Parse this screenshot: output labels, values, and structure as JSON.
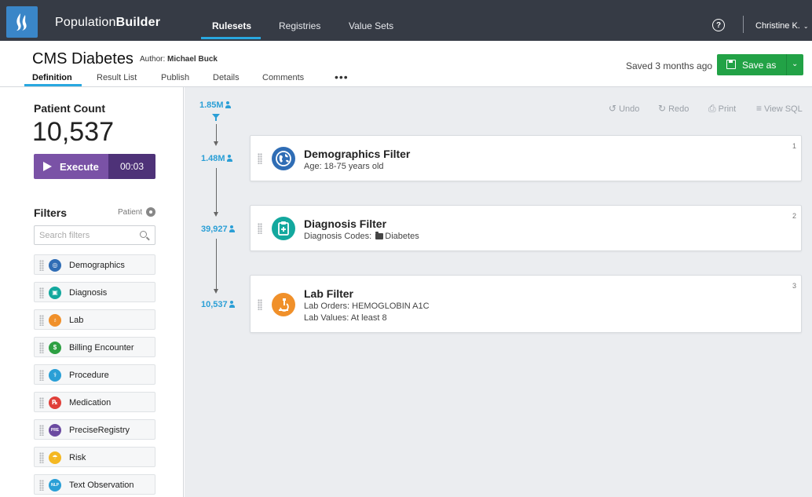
{
  "app": {
    "brand_light": "Population",
    "brand_bold": "Builder",
    "nav": [
      {
        "label": "Rulesets"
      },
      {
        "label": "Registries"
      },
      {
        "label": "Value Sets"
      }
    ],
    "help_glyph": "?",
    "user": "Christine K.",
    "user_chevron": "⌄"
  },
  "document": {
    "title": "CMS Diabetes",
    "author_label": "Author:",
    "author_name": "Michael Buck",
    "tabs": [
      {
        "label": "Definition"
      },
      {
        "label": "Result List"
      },
      {
        "label": "Publish"
      },
      {
        "label": "Details"
      },
      {
        "label": "Comments"
      }
    ],
    "more": "•••",
    "saved_status": "Saved 3 months ago",
    "save_label": "Save as",
    "save_chevron": "⌄"
  },
  "sidebar": {
    "patient_count_label": "Patient Count",
    "patient_count": "10,537",
    "execute_label": "Execute",
    "execute_time": "00:03",
    "filters_label": "Filters",
    "patient_label": "Patient",
    "search_placeholder": "Search filters",
    "filters": [
      {
        "label": "Demographics",
        "icon": "globe-icon",
        "color": "#2f6db5",
        "glyph": "◎"
      },
      {
        "label": "Diagnosis",
        "icon": "clipboard-icon",
        "color": "#13a89e",
        "glyph": "▣"
      },
      {
        "label": "Lab",
        "icon": "microscope-icon",
        "color": "#f0902a",
        "glyph": "♁"
      },
      {
        "label": "Billing Encounter",
        "icon": "billing-icon",
        "color": "#2ea043",
        "glyph": "$"
      },
      {
        "label": "Procedure",
        "icon": "procedure-icon",
        "color": "#2a9fd6",
        "glyph": "⚕"
      },
      {
        "label": "Medication",
        "icon": "medication-icon",
        "color": "#e0403a",
        "glyph": "℞"
      },
      {
        "label": "PreciseRegistry",
        "icon": "registry-icon",
        "color": "#6b4aa0",
        "glyph": "PRE"
      },
      {
        "label": "Risk",
        "icon": "umbrella-icon",
        "color": "#f4b823",
        "glyph": "☂"
      },
      {
        "label": "Text Observation",
        "icon": "nlp-icon",
        "color": "#2a9fd6",
        "glyph": "NLP"
      }
    ]
  },
  "toolbar": {
    "undo": "Undo",
    "redo": "Redo",
    "print": "Print",
    "view_sql": "View SQL"
  },
  "flow": {
    "counts": [
      "1.85M",
      "1.48M",
      "39,927",
      "10,537"
    ]
  },
  "cards": [
    {
      "number": "1",
      "title": "Demographics Filter",
      "lines": [
        "Age:  18-75 years old"
      ],
      "icon": "globe-icon",
      "color": "#2f6db5"
    },
    {
      "number": "2",
      "title": "Diagnosis Filter",
      "line_prefix": "Diagnosis Codes:",
      "line_value": "Diabetes",
      "icon": "clipboard-icon",
      "color": "#13a89e"
    },
    {
      "number": "3",
      "title": "Lab Filter",
      "lines": [
        "Lab Orders: HEMOGLOBIN A1C",
        "Lab Values: At least 8"
      ],
      "icon": "microscope-icon",
      "color": "#f0902a"
    }
  ],
  "colors": {
    "topbar": "#363b45",
    "accent": "#29a8e0",
    "save_green": "#22a246",
    "execute_purple": "#7a52a6",
    "execute_dark": "#4e3278",
    "flow_blue": "#2b9fd6"
  }
}
